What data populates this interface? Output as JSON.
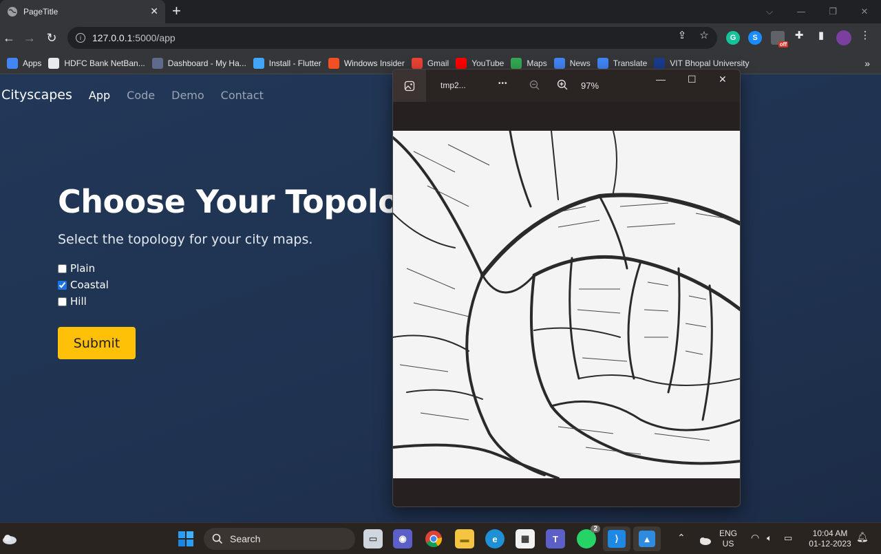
{
  "browser": {
    "tab_title": "PageTitle",
    "tab_close": "✕",
    "new_tab": "+",
    "url_host": "127.0.0.1",
    "url_rest": ":5000/app",
    "window_controls": [
      "⌵",
      "—",
      "❐",
      "✕"
    ],
    "bookmarks": [
      {
        "label": "Apps",
        "icon": "apps-grid-icon",
        "color": "#4285f4"
      },
      {
        "label": "HDFC Bank NetBan...",
        "icon": "globe-icon",
        "color": "#e8eaed"
      },
      {
        "label": "Dashboard - My Ha...",
        "icon": "dashboard-icon",
        "color": "#5f6b8a"
      },
      {
        "label": "Install - Flutter",
        "icon": "flutter-icon",
        "color": "#42a5f5"
      },
      {
        "label": "Windows Insider",
        "icon": "windows-icon",
        "color": "#f25022"
      },
      {
        "label": "Gmail",
        "icon": "gmail-icon",
        "color": "#ea4335"
      },
      {
        "label": "YouTube",
        "icon": "youtube-icon",
        "color": "#ff0000"
      },
      {
        "label": "Maps",
        "icon": "maps-icon",
        "color": "#34a853"
      },
      {
        "label": "News",
        "icon": "news-icon",
        "color": "#4285f4"
      },
      {
        "label": "Translate",
        "icon": "translate-icon",
        "color": "#4285f4"
      },
      {
        "label": "VIT Bhopal University",
        "icon": "university-icon",
        "color": "#1a3c8c"
      }
    ],
    "bookmarks_more": "»",
    "extension_badge": "off"
  },
  "page": {
    "brand": "Cityscapes",
    "nav": [
      "App",
      "Code",
      "Demo",
      "Contact"
    ],
    "title": "Choose Your Topology",
    "subtitle": "Select the topology for your city maps.",
    "options": [
      {
        "label": "Plain",
        "checked": false
      },
      {
        "label": "Coastal",
        "checked": true
      },
      {
        "label": "Hill",
        "checked": false
      }
    ],
    "submit_label": "Submit",
    "submit_color": "#ffc107"
  },
  "viewer": {
    "file_name": "tmp2...",
    "more": "•••",
    "zoom": "97%",
    "controls": [
      "—",
      "☐",
      "✕"
    ]
  },
  "taskbar": {
    "search_label": "Search",
    "whatsapp_badge": "2",
    "lang_top": "ENG",
    "lang_bottom": "US",
    "time": "10:04 AM",
    "date": "01-12-2023"
  }
}
